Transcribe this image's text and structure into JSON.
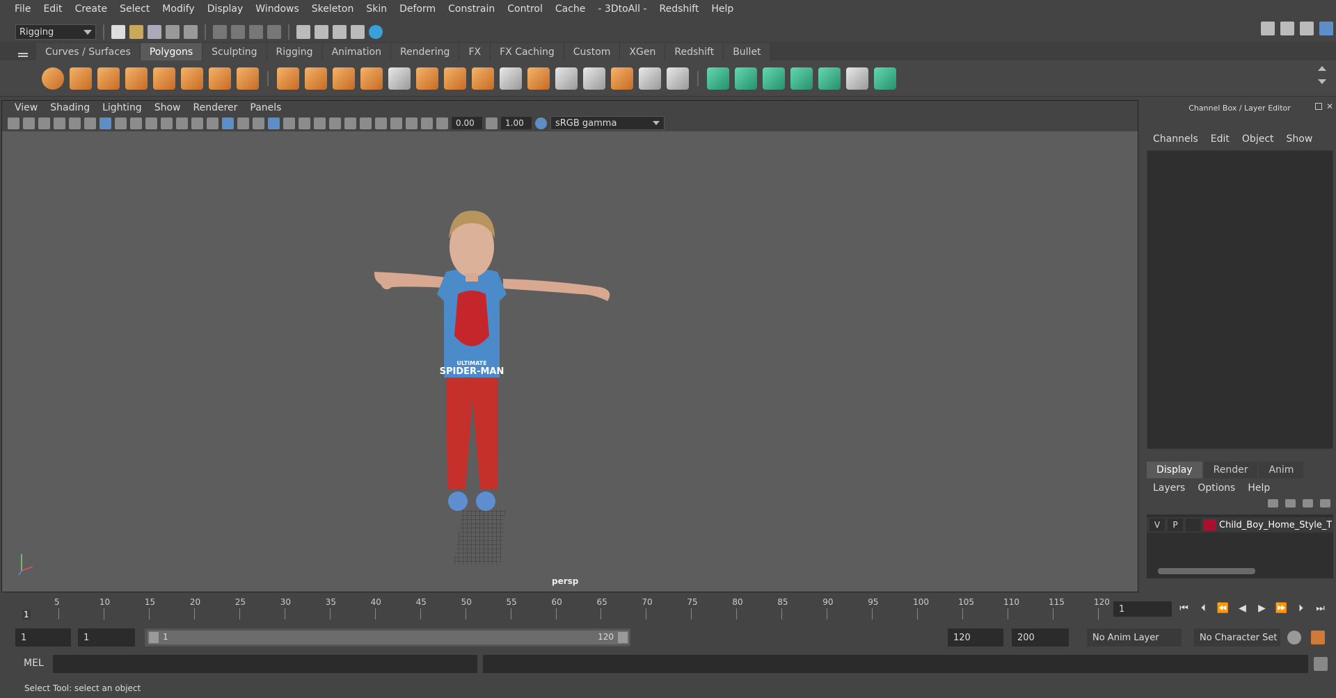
{
  "menubar": [
    "File",
    "Edit",
    "Create",
    "Select",
    "Modify",
    "Display",
    "Windows",
    "Skeleton",
    "Skin",
    "Deform",
    "Constrain",
    "Control",
    "Cache",
    "- 3DtoAll -",
    "Redshift",
    "Help"
  ],
  "statusline": {
    "mode": "Rigging"
  },
  "shelf_tabs": [
    {
      "label": "Curves / Surfaces",
      "active": false
    },
    {
      "label": "Polygons",
      "active": true
    },
    {
      "label": "Sculpting",
      "active": false
    },
    {
      "label": "Rigging",
      "active": false
    },
    {
      "label": "Animation",
      "active": false
    },
    {
      "label": "Rendering",
      "active": false
    },
    {
      "label": "FX",
      "active": false
    },
    {
      "label": "FX Caching",
      "active": false
    },
    {
      "label": "Custom",
      "active": false
    },
    {
      "label": "XGen",
      "active": false
    },
    {
      "label": "Redshift",
      "active": false
    },
    {
      "label": "Bullet",
      "active": false
    }
  ],
  "viewport": {
    "menu": [
      "View",
      "Shading",
      "Lighting",
      "Show",
      "Renderer",
      "Panels"
    ],
    "exposure": "0.00",
    "gamma": "1.00",
    "color_space": "sRGB gamma",
    "camera": "persp",
    "shirt_text": "SPIDER-MAN",
    "shirt_subtext": "ULTIMATE"
  },
  "right_panel": {
    "title": "Channel Box / Layer Editor",
    "menu": [
      "Channels",
      "Edit",
      "Object",
      "Show"
    ],
    "tabs": [
      {
        "label": "Display",
        "active": true
      },
      {
        "label": "Render",
        "active": false
      },
      {
        "label": "Anim",
        "active": false
      }
    ],
    "layer_menu": [
      "Layers",
      "Options",
      "Help"
    ],
    "layer": {
      "v": "V",
      "p": "P",
      "name": "Child_Boy_Home_Style_T",
      "color": "#a8102e"
    }
  },
  "timeslider": {
    "ticks": [
      "5",
      "10",
      "15",
      "20",
      "25",
      "30",
      "35",
      "40",
      "45",
      "50",
      "55",
      "60",
      "65",
      "70",
      "75",
      "80",
      "85",
      "90",
      "95",
      "100",
      "105",
      "110",
      "115",
      "120"
    ],
    "start_marker": "1",
    "current_frame": "1"
  },
  "range": {
    "start": "1",
    "playback_start": "1",
    "slider_start": "1",
    "slider_end": "120",
    "playback_end": "120",
    "end": "200",
    "anim_layer": "No Anim Layer",
    "character_set": "No Character Set"
  },
  "cmdline": {
    "label": "MEL"
  },
  "helpline": {
    "text": "Select Tool: select an object"
  }
}
